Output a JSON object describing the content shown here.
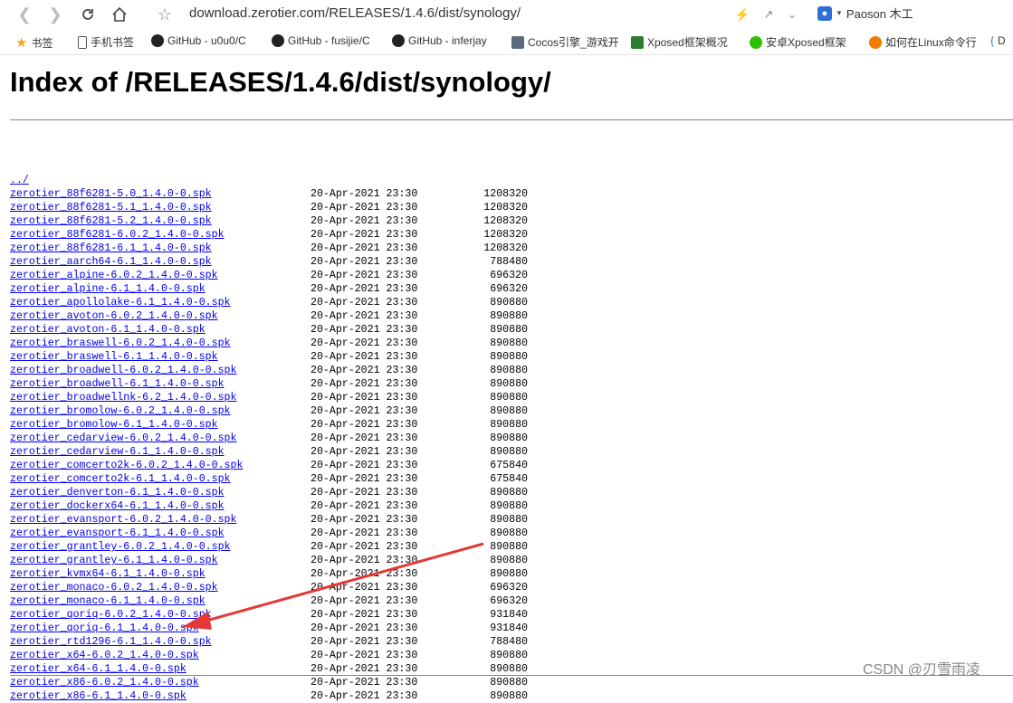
{
  "browser": {
    "url": "download.zerotier.com/RELEASES/1.4.6/dist/synology/",
    "profile_name": "Paoson 木工",
    "bookmarks": [
      {
        "label": "书签",
        "icon": "star-icon"
      },
      {
        "label": "手机书签",
        "icon": "phone-icon"
      },
      {
        "label": "GitHub - u0u0/C",
        "icon": "github-icon"
      },
      {
        "label": "GitHub - fusijie/C",
        "icon": "github-icon"
      },
      {
        "label": "GitHub - inferjay",
        "icon": "github-icon"
      },
      {
        "label": "Cocos引擎_游戏开",
        "icon": "cocos-icon"
      },
      {
        "label": "Xposed框架概况",
        "icon": "xposed-icon"
      },
      {
        "label": "安卓Xposed框架",
        "icon": "wechat-icon"
      },
      {
        "label": "如何在Linux命令行",
        "icon": "s-icon"
      },
      {
        "label": "D",
        "icon": "bracket-icon"
      }
    ]
  },
  "page": {
    "title": "Index of /RELEASES/1.4.6/dist/synology/",
    "parent_link": "../",
    "files": [
      {
        "name": "zerotier_88f6281-5.0_1.4.0-0.spk",
        "date": "20-Apr-2021 23:30",
        "size": "1208320"
      },
      {
        "name": "zerotier_88f6281-5.1_1.4.0-0.spk",
        "date": "20-Apr-2021 23:30",
        "size": "1208320"
      },
      {
        "name": "zerotier_88f6281-5.2_1.4.0-0.spk",
        "date": "20-Apr-2021 23:30",
        "size": "1208320"
      },
      {
        "name": "zerotier_88f6281-6.0.2_1.4.0-0.spk",
        "date": "20-Apr-2021 23:30",
        "size": "1208320"
      },
      {
        "name": "zerotier_88f6281-6.1_1.4.0-0.spk",
        "date": "20-Apr-2021 23:30",
        "size": "1208320"
      },
      {
        "name": "zerotier_aarch64-6.1_1.4.0-0.spk",
        "date": "20-Apr-2021 23:30",
        "size": "788480"
      },
      {
        "name": "zerotier_alpine-6.0.2_1.4.0-0.spk",
        "date": "20-Apr-2021 23:30",
        "size": "696320"
      },
      {
        "name": "zerotier_alpine-6.1_1.4.0-0.spk",
        "date": "20-Apr-2021 23:30",
        "size": "696320"
      },
      {
        "name": "zerotier_apollolake-6.1_1.4.0-0.spk",
        "date": "20-Apr-2021 23:30",
        "size": "890880"
      },
      {
        "name": "zerotier_avoton-6.0.2_1.4.0-0.spk",
        "date": "20-Apr-2021 23:30",
        "size": "890880"
      },
      {
        "name": "zerotier_avoton-6.1_1.4.0-0.spk",
        "date": "20-Apr-2021 23:30",
        "size": "890880"
      },
      {
        "name": "zerotier_braswell-6.0.2_1.4.0-0.spk",
        "date": "20-Apr-2021 23:30",
        "size": "890880"
      },
      {
        "name": "zerotier_braswell-6.1_1.4.0-0.spk",
        "date": "20-Apr-2021 23:30",
        "size": "890880"
      },
      {
        "name": "zerotier_broadwell-6.0.2_1.4.0-0.spk",
        "date": "20-Apr-2021 23:30",
        "size": "890880"
      },
      {
        "name": "zerotier_broadwell-6.1_1.4.0-0.spk",
        "date": "20-Apr-2021 23:30",
        "size": "890880"
      },
      {
        "name": "zerotier_broadwellnk-6.2_1.4.0-0.spk",
        "date": "20-Apr-2021 23:30",
        "size": "890880"
      },
      {
        "name": "zerotier_bromolow-6.0.2_1.4.0-0.spk",
        "date": "20-Apr-2021 23:30",
        "size": "890880"
      },
      {
        "name": "zerotier_bromolow-6.1_1.4.0-0.spk",
        "date": "20-Apr-2021 23:30",
        "size": "890880"
      },
      {
        "name": "zerotier_cedarview-6.0.2_1.4.0-0.spk",
        "date": "20-Apr-2021 23:30",
        "size": "890880"
      },
      {
        "name": "zerotier_cedarview-6.1_1.4.0-0.spk",
        "date": "20-Apr-2021 23:30",
        "size": "890880"
      },
      {
        "name": "zerotier_comcerto2k-6.0.2_1.4.0-0.spk",
        "date": "20-Apr-2021 23:30",
        "size": "675840"
      },
      {
        "name": "zerotier_comcerto2k-6.1_1.4.0-0.spk",
        "date": "20-Apr-2021 23:30",
        "size": "675840"
      },
      {
        "name": "zerotier_denverton-6.1_1.4.0-0.spk",
        "date": "20-Apr-2021 23:30",
        "size": "890880"
      },
      {
        "name": "zerotier_dockerx64-6.1_1.4.0-0.spk",
        "date": "20-Apr-2021 23:30",
        "size": "890880"
      },
      {
        "name": "zerotier_evansport-6.0.2_1.4.0-0.spk",
        "date": "20-Apr-2021 23:30",
        "size": "890880"
      },
      {
        "name": "zerotier_evansport-6.1_1.4.0-0.spk",
        "date": "20-Apr-2021 23:30",
        "size": "890880"
      },
      {
        "name": "zerotier_grantley-6.0.2_1.4.0-0.spk",
        "date": "20-Apr-2021 23:30",
        "size": "890880"
      },
      {
        "name": "zerotier_grantley-6.1_1.4.0-0.spk",
        "date": "20-Apr-2021 23:30",
        "size": "890880"
      },
      {
        "name": "zerotier_kvmx64-6.1_1.4.0-0.spk",
        "date": "20-Apr-2021 23:30",
        "size": "890880"
      },
      {
        "name": "zerotier_monaco-6.0.2_1.4.0-0.spk",
        "date": "20-Apr-2021 23:30",
        "size": "696320"
      },
      {
        "name": "zerotier_monaco-6.1_1.4.0-0.spk",
        "date": "20-Apr-2021 23:30",
        "size": "696320"
      },
      {
        "name": "zerotier_qoriq-6.0.2_1.4.0-0.spk",
        "date": "20-Apr-2021 23:30",
        "size": "931840"
      },
      {
        "name": "zerotier_qoriq-6.1_1.4.0-0.spk",
        "date": "20-Apr-2021 23:30",
        "size": "931840"
      },
      {
        "name": "zerotier_rtd1296-6.1_1.4.0-0.spk",
        "date": "20-Apr-2021 23:30",
        "size": "788480"
      },
      {
        "name": "zerotier_x64-6.0.2_1.4.0-0.spk",
        "date": "20-Apr-2021 23:30",
        "size": "890880"
      },
      {
        "name": "zerotier_x64-6.1_1.4.0-0.spk",
        "date": "20-Apr-2021 23:30",
        "size": "890880"
      },
      {
        "name": "zerotier_x86-6.0.2_1.4.0-0.spk",
        "date": "20-Apr-2021 23:30",
        "size": "890880"
      },
      {
        "name": "zerotier_x86-6.1_1.4.0-0.spk",
        "date": "20-Apr-2021 23:30",
        "size": "890880"
      }
    ]
  },
  "watermark": "CSDN @刃雪雨凌",
  "colors": {
    "link": "#0000ee",
    "arrow": "#e53935"
  }
}
